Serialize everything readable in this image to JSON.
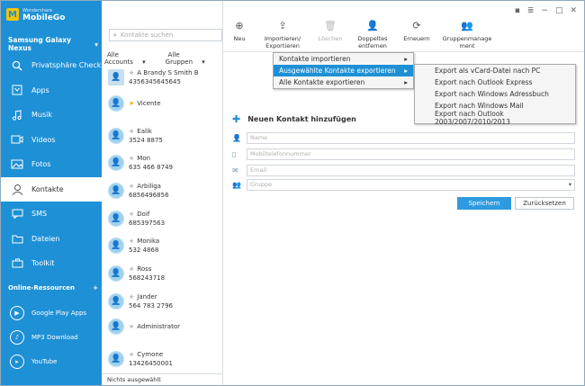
{
  "app": {
    "brand_small": "Wondershare",
    "brand_name": "MobileGo",
    "logo_letter": "M"
  },
  "device": {
    "name": "Samsung Galaxy Nexus"
  },
  "nav": [
    {
      "label": "Privatsphäre Check",
      "icon": "magnifier-icon"
    },
    {
      "label": "Apps",
      "icon": "apps-icon"
    },
    {
      "label": "Musik",
      "icon": "music-icon"
    },
    {
      "label": "Videos",
      "icon": "video-icon"
    },
    {
      "label": "Fotos",
      "icon": "photo-icon"
    },
    {
      "label": "Kontakte",
      "icon": "contacts-icon",
      "active": true
    },
    {
      "label": "SMS",
      "icon": "sms-icon"
    },
    {
      "label": "Dateien",
      "icon": "folder-icon"
    },
    {
      "label": "Toolkit",
      "icon": "toolkit-icon"
    }
  ],
  "online": {
    "title": "Online-Ressourcen",
    "items": [
      {
        "label": "Google Play Apps",
        "icon": "google-play-icon"
      },
      {
        "label": "MP3 Download",
        "icon": "mp3-icon"
      },
      {
        "label": "YouTube",
        "icon": "youtube-icon"
      }
    ]
  },
  "search": {
    "placeholder": "Kontakte suchen"
  },
  "filters": {
    "accounts": "Alle Accounts",
    "groups": "Alle Gruppen"
  },
  "contacts": [
    {
      "name": "A Brandy S Smith B",
      "phone": "4356345645645"
    },
    {
      "name": "Vicente",
      "phone": "",
      "favorite": true
    },
    {
      "name": "Ealik",
      "phone": "3524 8875"
    },
    {
      "name": "Mon",
      "phone": "635 466 8749"
    },
    {
      "name": "Arbiliga",
      "phone": "6856496856"
    },
    {
      "name": "Doif",
      "phone": "685397563"
    },
    {
      "name": "Monika",
      "phone": "532 4868"
    },
    {
      "name": "Ross",
      "phone": "568243718"
    },
    {
      "name": "Jander",
      "phone": "564 783 2796"
    },
    {
      "name": "Administrator",
      "phone": ""
    },
    {
      "name": "Cymone",
      "phone": "13426450001"
    }
  ],
  "status": {
    "text": "Nichts ausgewählt"
  },
  "toolbar": {
    "new": "Neu",
    "import_export": "Importieren/\nExportieren",
    "delete": "Löschen",
    "duplicates": "Doppeltes\nentfernen",
    "refresh": "Erneuern",
    "group_mgmt": "Gruppenmanage\nment"
  },
  "form": {
    "title": "Neuen Kontakt hinzufügen",
    "name_placeholder": "Name",
    "phone_placeholder": "Mobiltelefonnummer",
    "email_placeholder": "Email",
    "group_placeholder": "Gruppe",
    "save": "Speichern",
    "reset": "Zurücksetzen"
  },
  "menu": {
    "items": [
      "Kontakte importieren",
      "Ausgewählte Kontakte exportieren",
      "Alle Kontakte exportieren"
    ],
    "highlighted_index": 1,
    "submenu": [
      "Export als vCard-Datei nach PC",
      "Export nach Outlook Express",
      "Export nach Windows Adressbuch",
      "Export nach Windows Mail",
      "Export nach Outlook 2003/2007/2010/2013"
    ]
  },
  "colors": {
    "accent": "#1e90d6",
    "button": "#2e9be0",
    "favorite_star": "#f2b400"
  }
}
